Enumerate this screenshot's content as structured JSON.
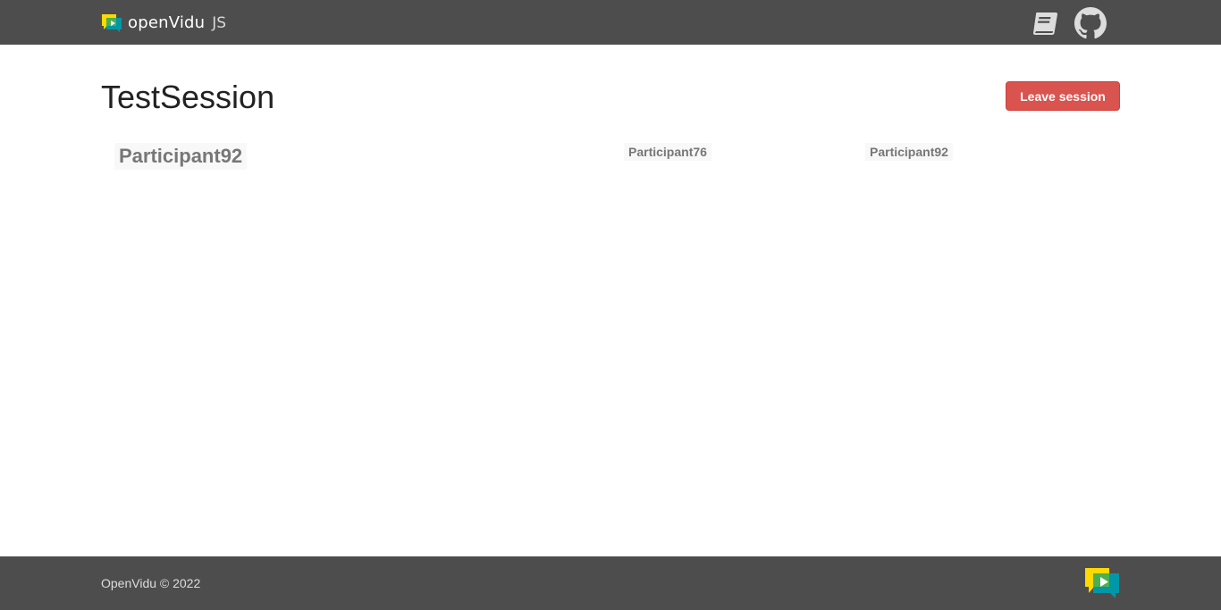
{
  "navbar": {
    "brand_name": "openVidu",
    "brand_suffix": "JS",
    "icons": [
      "book-icon",
      "github-icon"
    ]
  },
  "session": {
    "title": "TestSession",
    "leave_label": "Leave session"
  },
  "main_video": {
    "participant": "Participant92"
  },
  "video_container": [
    {
      "participant": "Participant76"
    },
    {
      "participant": "Participant92"
    }
  ],
  "footer": {
    "copyright": "OpenVidu © 2022"
  },
  "colors": {
    "header_bg": "#4d4d4d",
    "danger": "#d9534f",
    "logo_yellow": "#ffd900",
    "logo_teal": "#0097a7",
    "logo_green": "#4caf50"
  }
}
